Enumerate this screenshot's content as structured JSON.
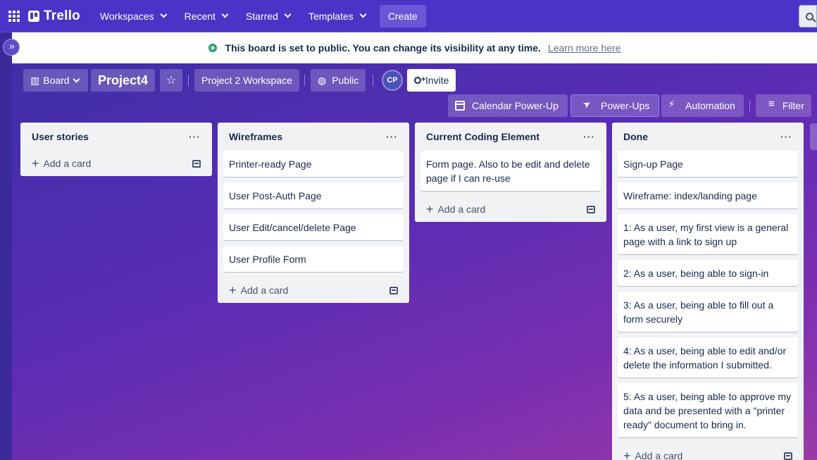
{
  "topnav": {
    "logo": "Trello",
    "menus": [
      "Workspaces",
      "Recent",
      "Starred",
      "Templates"
    ],
    "create": "Create"
  },
  "banner": {
    "text": "This board is set to public. You can change its visibility at any time.",
    "link": "Learn more here"
  },
  "board_header": {
    "view": "Board",
    "name": "Project4",
    "workspace": "Project 2 Workspace",
    "visibility": "Public",
    "avatar_initials": "CP",
    "invite": "Invite",
    "calendar": "Calendar Power-Up",
    "powerups": "Power-Ups",
    "automation": "Automation",
    "filter": "Filter"
  },
  "lists": [
    {
      "title": "User stories",
      "cards": [],
      "add": "Add a card"
    },
    {
      "title": "Wireframes",
      "cards": [
        "Printer-ready Page",
        "User Post-Auth Page",
        "User Edit/cancel/delete Page",
        "User Profile Form"
      ],
      "add": "Add a card"
    },
    {
      "title": "Current Coding Element",
      "cards": [
        "Form page. Also to be edit and delete page if I can re-use"
      ],
      "add": "Add a card"
    },
    {
      "title": "Done",
      "cards": [
        "Sign-up Page",
        "Wireframe: index/landing page",
        "1: As a user, my first view is a general page with a link to sign up",
        "2: As a user, being able to sign-in",
        "3: As a user, being able to fill out a form securely",
        "4: As a user, being able to edit and/or delete the information I submitted.",
        "5: As a user, being able to approve my data and be presented with a \"printer ready\" document to bring in."
      ],
      "add": "Add a card"
    }
  ],
  "colors": {
    "nav": "#4a34c8",
    "create": "#6a56d6",
    "list_bg": "#f1f2f4"
  }
}
